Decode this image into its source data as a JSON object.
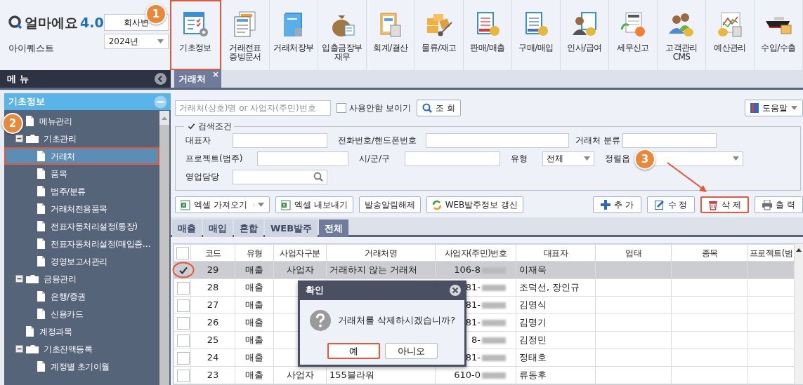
{
  "app": {
    "logo": "얼마에요",
    "logo_version": "4.0",
    "company": "아이퀘스트",
    "company_button": "회사변",
    "year": "2024년"
  },
  "toolbar": [
    {
      "label": "기초정보",
      "highlighted": true
    },
    {
      "label": "거래전표\n증빙문서",
      "highlighted": false
    },
    {
      "label": "거래처장부",
      "highlighted": false
    },
    {
      "label": "입출금장부\n재무",
      "highlighted": false
    },
    {
      "label": "회계/결산",
      "highlighted": false
    },
    {
      "label": "물류/재고",
      "highlighted": false
    },
    {
      "label": "판매/매출",
      "highlighted": false
    },
    {
      "label": "구매/매입",
      "highlighted": false
    },
    {
      "label": "인사/급여",
      "highlighted": false
    },
    {
      "label": "세무신고",
      "highlighted": false
    },
    {
      "label": "고객관리\nCMS",
      "highlighted": false
    },
    {
      "label": "예산관리",
      "highlighted": false
    },
    {
      "label": "수입/수출",
      "highlighted": false
    }
  ],
  "menu_bar": {
    "title": "메 뉴"
  },
  "tabs": [
    {
      "label": "거래처",
      "selected": true,
      "close": "×"
    }
  ],
  "sidebar": {
    "section": "기초정보",
    "items": [
      {
        "label": "메뉴관리",
        "selected": false,
        "highlighted": false
      },
      {
        "label": "기초관리",
        "expanded": true,
        "children": [
          {
            "label": "거래처",
            "selected": true,
            "highlighted": true
          },
          {
            "label": "품목",
            "selected": false,
            "highlighted": false
          },
          {
            "label": "범주/분류",
            "selected": false,
            "highlighted": false
          },
          {
            "label": "거래처전용품목",
            "selected": false,
            "highlighted": false
          },
          {
            "label": "전표자동처리설정(통장)",
            "selected": false,
            "highlighted": false
          },
          {
            "label": "전표자동처리설정(매입증…",
            "selected": false,
            "highlighted": false
          },
          {
            "label": "경영보고서관리",
            "selected": false,
            "highlighted": false
          }
        ]
      },
      {
        "label": "금융관리",
        "expanded": true,
        "children": [
          {
            "label": "은행/증권",
            "selected": false,
            "highlighted": false
          },
          {
            "label": "신용카드",
            "selected": false,
            "highlighted": false
          }
        ]
      },
      {
        "label": "계정과목",
        "selected": false,
        "highlighted": false
      },
      {
        "label": "기초잔액등록",
        "expanded": true,
        "children": [
          {
            "label": "계정별 초기이월",
            "selected": false,
            "highlighted": false
          }
        ]
      }
    ]
  },
  "search": {
    "placeholder": "거래처(상호)명 or 사업자(주민)번호",
    "show_unused": {
      "label": "사용안함 보이기",
      "checked": false
    },
    "search_button": "조 회",
    "help_button": "도움말"
  },
  "filters": {
    "legend": "검색조건",
    "checked": true,
    "rows": [
      [
        {
          "label": "대표자",
          "kind": "text"
        },
        {
          "label": "전화번호/핸드폰번호",
          "kind": "text"
        },
        {
          "label": "거래처 분류",
          "kind": "text"
        }
      ],
      [
        {
          "label": "프로젝트(범주)",
          "kind": "text"
        },
        {
          "label": "시/군/구",
          "kind": "text"
        },
        {
          "label": "유형",
          "kind": "select",
          "value": "전체"
        },
        {
          "label": "정렬옵",
          "kind": "select"
        }
      ],
      [
        {
          "label": "영업담당",
          "kind": "search"
        }
      ]
    ]
  },
  "actions": {
    "left": [
      {
        "label": "엑셀 가져오기",
        "kind": "excel",
        "dropdown": true,
        "highlighted": false
      },
      {
        "label": "엑셀 내보내기",
        "kind": "excel",
        "dropdown": false,
        "highlighted": false
      },
      {
        "label": "발송알림해제",
        "kind": "plain",
        "dropdown": false,
        "highlighted": false
      },
      {
        "label": "WEB발주정보 갱신",
        "kind": "refresh",
        "dropdown": false,
        "highlighted": false
      }
    ],
    "right": [
      {
        "label": "추 가",
        "kind": "add",
        "dropdown": false,
        "highlighted": false
      },
      {
        "label": "수 정",
        "kind": "edit",
        "dropdown": false,
        "highlighted": false
      },
      {
        "label": "삭 제",
        "kind": "delete",
        "dropdown": false,
        "highlighted": true
      },
      {
        "label": "출 력",
        "kind": "print",
        "dropdown": false,
        "highlighted": false
      }
    ]
  },
  "subtabs": [
    {
      "label": "매출",
      "selected": false
    },
    {
      "label": "매입",
      "selected": false
    },
    {
      "label": "혼합",
      "selected": false
    },
    {
      "label": "WEB발주",
      "selected": false
    },
    {
      "label": "전체",
      "selected": true
    }
  ],
  "table": {
    "all_checked": false,
    "columns": [
      "코드",
      "유형",
      "사업자구분",
      "거래처명",
      "사업자(주민)번호",
      "대표자",
      "업태",
      "종목",
      "프로젝트(범"
    ],
    "rows": [
      {
        "checked": true,
        "selected": true,
        "highlighted": true,
        "code": "29",
        "type": "매출",
        "biz_kind": "사업자",
        "name": "거래하지 않는 거래처",
        "bizno": "106-8",
        "rep": "이재욱"
      },
      {
        "checked": false,
        "selected": false,
        "highlighted": false,
        "code": "28",
        "type": "매출",
        "bizno": "81-",
        "rep": "조덕선, 장인규"
      },
      {
        "checked": false,
        "selected": false,
        "highlighted": false,
        "code": "27",
        "type": "매출",
        "bizno": "81-",
        "rep": "김명식"
      },
      {
        "checked": false,
        "selected": false,
        "highlighted": false,
        "code": "26",
        "type": "매출",
        "bizno": "81-",
        "rep": "김명기"
      },
      {
        "checked": false,
        "selected": false,
        "highlighted": false,
        "code": "25",
        "type": "매출",
        "bizno": "8-",
        "rep": "김정민"
      },
      {
        "checked": false,
        "selected": false,
        "highlighted": false,
        "code": "24",
        "type": "매출",
        "bizno": "81-",
        "rep": "정태호"
      },
      {
        "checked": false,
        "selected": false,
        "highlighted": false,
        "code": "23",
        "type": "매출",
        "biz_kind": "사업자",
        "name": "155블라워",
        "bizno": "610-0",
        "rep": "류동후"
      }
    ]
  },
  "dialog": {
    "title": "확인",
    "message": "거래처를 삭제하시겠습니까?",
    "buttons": [
      {
        "label": "예",
        "highlighted": true
      },
      {
        "label": "아니오",
        "highlighted": false
      }
    ]
  },
  "annotations": [
    {
      "label": "1"
    },
    {
      "label": "2"
    },
    {
      "label": "3"
    }
  ]
}
